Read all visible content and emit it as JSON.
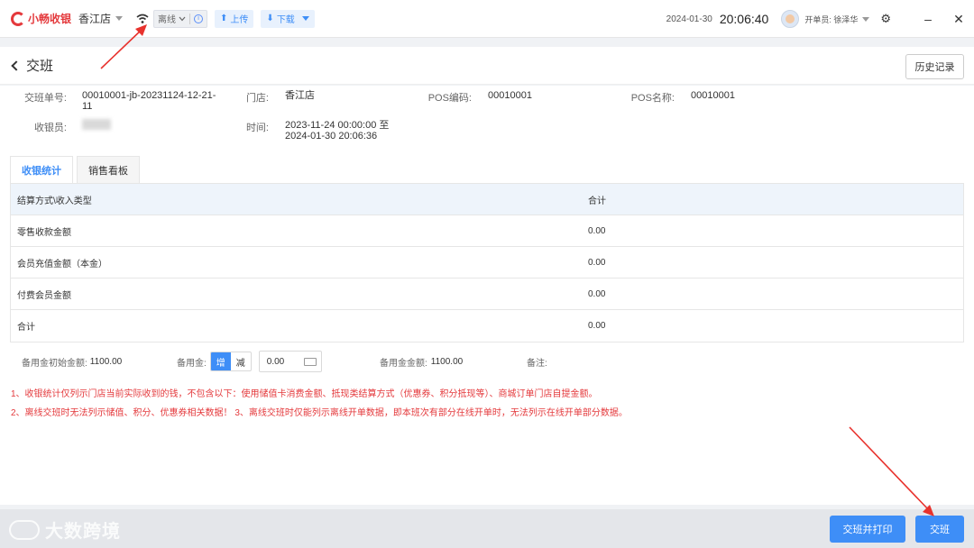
{
  "topbar": {
    "logo_text": "小畅收银",
    "store": "香江店",
    "status": "离线",
    "upload_label": "上传",
    "download_label": "下载",
    "date": "2024-01-30",
    "time": "20:06:40",
    "opener_label": "开单员: 徐泽华"
  },
  "page": {
    "title": "交班",
    "history_button": "历史记录"
  },
  "shift_info": {
    "order_no_label": "交班单号:",
    "order_no_line1": "00010001-jb-20231124-12-21-",
    "order_no_line2": "11",
    "store_label": "门店:",
    "store_value": "香江店",
    "pos_code_label": "POS编码:",
    "pos_code_value": "00010001",
    "pos_name_label": "POS名称:",
    "pos_name_value": "00010001",
    "cashier_label": "收银员:",
    "time_label": "时间:",
    "time_line1": "2023-11-24 00:00:00 至",
    "time_line2": "2024-01-30 20:06:36"
  },
  "tabs": [
    {
      "label": "收银统计",
      "active": true
    },
    {
      "label": "销售看板",
      "active": false
    }
  ],
  "table": {
    "headers": [
      "结算方式\\收入类型",
      "合计"
    ],
    "rows": [
      [
        "零售收款金额",
        "0.00"
      ],
      [
        "会员充值金额（本金）",
        "0.00"
      ],
      [
        "付费会员金额",
        "0.00"
      ],
      [
        "合计",
        "0.00"
      ]
    ]
  },
  "reserve": {
    "initial_label": "备用金初始金额:",
    "initial_value": "1100.00",
    "reserve_label": "备用金:",
    "increase": "增",
    "decrease": "减",
    "amount_value": "0.00",
    "balance_label": "备用金金额:",
    "balance_value": "1100.00",
    "remark_label": "备注:"
  },
  "notes": [
    "1、收银统计仅列示门店当前实际收到的钱，不包含以下：使用储值卡消费金额、抵现类结算方式（优惠券、积分抵现等）、商城订单门店自提金额。",
    "2、离线交班时无法列示储值、积分、优惠券相关数据！ 3、离线交班时仅能列示离线开单数据，即本班次有部分在线开单时，无法列示在线开单部分数据。"
  ],
  "footer": {
    "watermark": "大数跨境",
    "print_shift_button": "交班并打印",
    "shift_button": "交班"
  },
  "colors": {
    "accent": "#3e8ef7",
    "brand": "#e4393c",
    "warning_text": "#e4393c"
  }
}
